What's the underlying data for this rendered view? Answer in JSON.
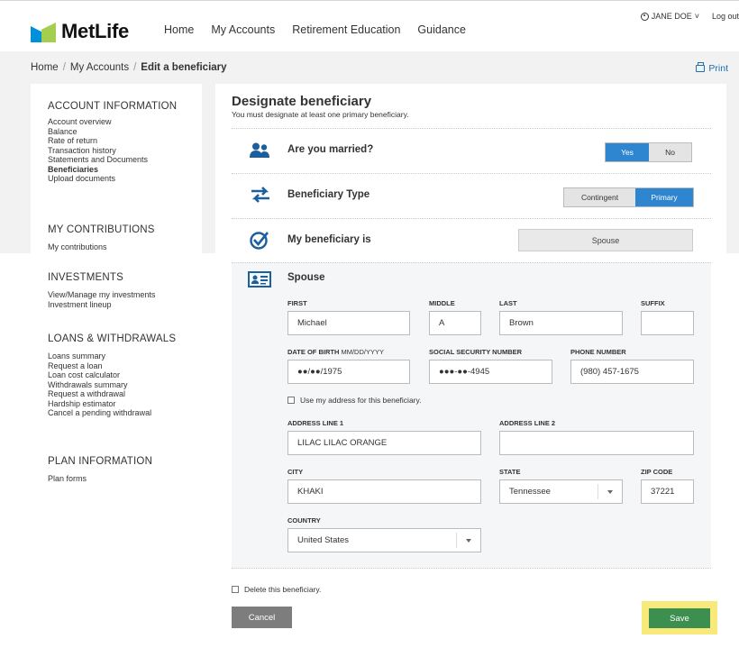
{
  "header": {
    "brand": "MetLife",
    "nav": [
      "Home",
      "My Accounts",
      "Retirement Education",
      "Guidance"
    ],
    "user_name": "JANE DOE",
    "user_caret": "˅",
    "logout": "Log out"
  },
  "breadcrumb": {
    "items": [
      "Home",
      "My Accounts"
    ],
    "current": "Edit a beneficiary",
    "print": "Print"
  },
  "sidebar": {
    "sections": [
      {
        "title": "ACCOUNT INFORMATION",
        "items": [
          "Account overview",
          "Balance",
          "Rate of return",
          "Transaction history",
          "Statements and Documents",
          "Beneficiaries",
          "Upload documents"
        ],
        "active": "Beneficiaries"
      },
      {
        "title": "MY CONTRIBUTIONS",
        "items": [
          "My contributions"
        ]
      },
      {
        "title": "INVESTMENTS",
        "items": [
          "View/Manage my investments",
          "Investment lineup"
        ]
      },
      {
        "title": "LOANS & WITHDRAWALS",
        "items": [
          "Loans summary",
          "Request a loan",
          "Loan cost calculator",
          "Withdrawals summary",
          "Request a withdrawal",
          "Hardship estimator",
          "Cancel a pending withdrawal"
        ]
      },
      {
        "title": "PLAN INFORMATION",
        "items": [
          "Plan forms"
        ]
      }
    ]
  },
  "main": {
    "title": "Designate beneficiary",
    "subtitle": "You must designate at least one primary beneficiary.",
    "married": {
      "label": "Are you married?",
      "yes": "Yes",
      "no": "No",
      "selected": "Yes"
    },
    "type": {
      "label": "Beneficiary Type",
      "contingent": "Contingent",
      "primary": "Primary",
      "selected": "Primary"
    },
    "relation": {
      "label": "My beneficiary is",
      "value": "Spouse"
    },
    "form": {
      "heading": "Spouse",
      "first_label": "FIRST",
      "first": "Michael",
      "middle_label": "MIDDLE",
      "middle": "A",
      "last_label": "LAST",
      "last": "Brown",
      "suffix_label": "SUFFIX",
      "suffix": "",
      "dob_label": "DATE OF BIRTH",
      "dob_hint": "MM/DD/YYYY",
      "dob": "●●/●●/1975",
      "ssn_label": "SOCIAL SECURITY NUMBER",
      "ssn": "●●●-●●-4945",
      "phone_label": "PHONE NUMBER",
      "phone": "(980) 457-1675",
      "use_address": "Use my address for this beneficiary.",
      "addr1_label": "ADDRESS LINE 1",
      "addr1": "LILAC LILAC ORANGE",
      "addr2_label": "ADDRESS LINE 2",
      "addr2": "",
      "city_label": "CITY",
      "city": "KHAKI",
      "state_label": "STATE",
      "state": "Tennessee",
      "zip_label": "ZIP CODE",
      "zip": "37221",
      "country_label": "COUNTRY",
      "country": "United States"
    },
    "delete": "Delete this beneficiary.",
    "cancel": "Cancel",
    "save": "Save"
  },
  "colors": {
    "accent": "#2e86d1",
    "save": "#3c8f4e",
    "highlight": "#f7e97a",
    "logo_blue": "#0090da",
    "logo_green": "#a4ce4e"
  }
}
